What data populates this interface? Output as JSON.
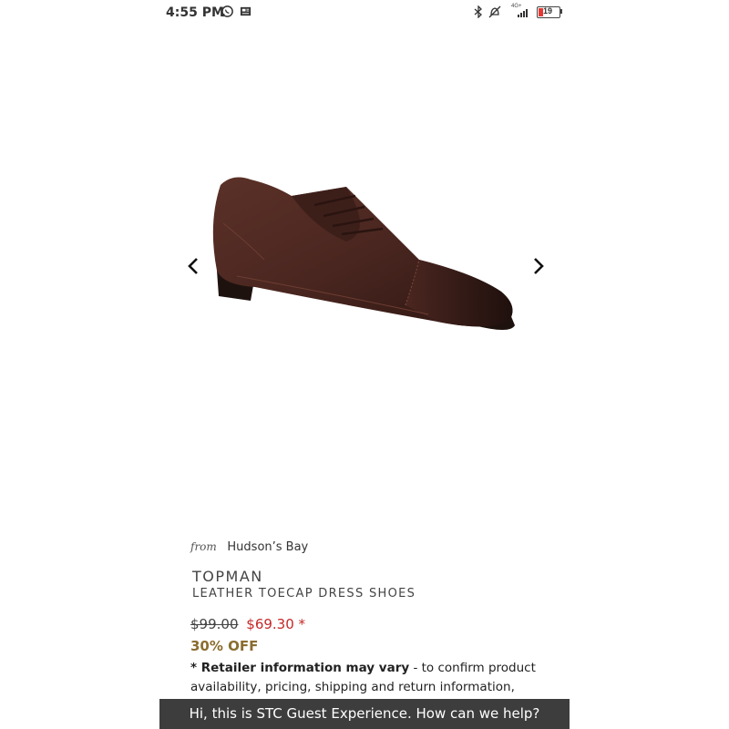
{
  "status_bar": {
    "time": "4:55 PM",
    "left_icons": [
      "whatsapp-icon",
      "news-icon"
    ],
    "right_icons": [
      "bluetooth-icon",
      "alarm-off-icon",
      "signal-icon",
      "battery-icon"
    ],
    "network": "4G+",
    "battery_level": "19",
    "battery_color": "#e53935"
  },
  "carousel": {
    "prev_icon": "chevron-left-icon",
    "next_icon": "chevron-right-icon"
  },
  "product": {
    "from_label": "from",
    "retailer": "Hudson’s Bay",
    "brand": "TOPMAN",
    "name": "LEATHER TOECAP DRESS SHOES",
    "original_price": "$99.00",
    "sale_price": "$69.30 *",
    "discount": "30% OFF",
    "disclaimer_bold": "* Retailer information may vary",
    "disclaimer_rest": " - to confirm product availability, pricing, shipping and return information, please"
  },
  "chat": {
    "message": "Hi, this is STC Guest Experience. How can we help?"
  },
  "colors": {
    "sale": "#c62828",
    "discount": "#8a6d2f",
    "chat_bg": "#3d3d3d"
  }
}
